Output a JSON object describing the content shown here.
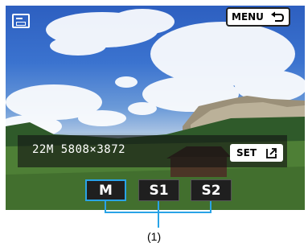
{
  "screen": {
    "menu_button": {
      "label": "MENU",
      "icon": "return-arrow-icon"
    },
    "mode_icon": "camera-screen-icon",
    "image_size": {
      "text": "22M 5808×3872"
    },
    "set_button": {
      "label": "SET",
      "icon": "export-icon"
    },
    "options": [
      {
        "label": "M",
        "selected": true
      },
      {
        "label": "S1",
        "selected": false
      },
      {
        "label": "S2",
        "selected": false
      }
    ]
  },
  "callout": {
    "label": "(1)"
  },
  "colors": {
    "selection": "#29a3e6",
    "bracket": "#29a3e6"
  }
}
